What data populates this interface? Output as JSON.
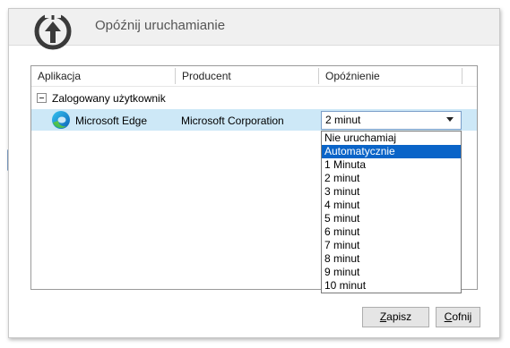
{
  "window": {
    "title": "Opóźnij uruchamianie"
  },
  "columns": [
    "Aplikacja",
    "Producent",
    "Opóźnienie"
  ],
  "group": {
    "label": "Zalogowany użytkownik"
  },
  "row": {
    "app_name": "Microsoft Edge",
    "publisher": "Microsoft Corporation",
    "delay": "2 minut"
  },
  "dropdown": {
    "options": [
      "Nie uruchamiaj",
      "Automatycznie",
      "1 Minuta",
      "2 minut",
      "3 minut",
      "4 minut",
      "5 minut",
      "6 minut",
      "7 minut",
      "8 minut",
      "9 minut",
      "10 minut"
    ],
    "highlighted_index": 1
  },
  "buttons": {
    "save": {
      "accel": "Z",
      "rest": "apisz"
    },
    "cancel": {
      "accel": "C",
      "rest": "ofnij"
    }
  },
  "colors": {
    "selection_row": "#cde8f7",
    "highlight": "#0a64c8",
    "arrow_light": "#7f9fc6",
    "arrow_dark": "#2a5f9a"
  },
  "icons": {
    "app": "timer-upload-icon",
    "edge": "edge-icon",
    "combo": "chevron-down-icon"
  }
}
